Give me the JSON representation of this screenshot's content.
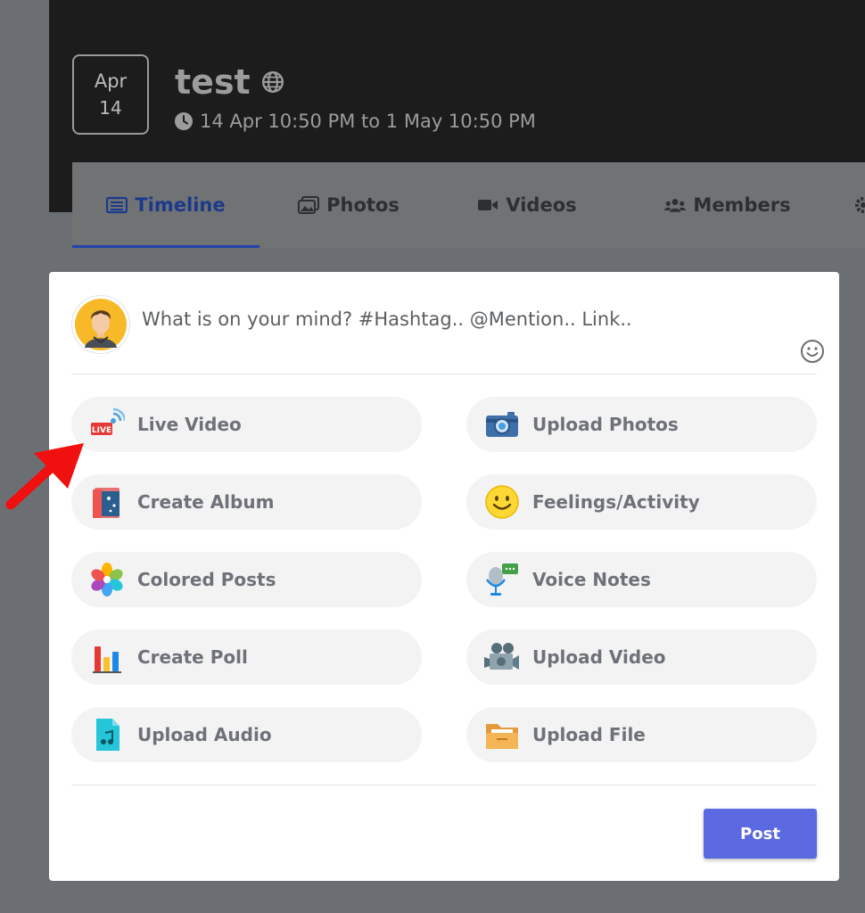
{
  "event": {
    "month": "Apr",
    "day": "14",
    "title": "test",
    "time": "14 Apr 10:50 PM to 1 May 10:50 PM"
  },
  "tabs": [
    {
      "label": "Timeline",
      "icon": "list-icon",
      "active": true
    },
    {
      "label": "Photos",
      "icon": "images-icon",
      "active": false
    },
    {
      "label": "Videos",
      "icon": "video-camera-icon",
      "active": false
    },
    {
      "label": "Members",
      "icon": "users-icon",
      "active": false
    }
  ],
  "composer": {
    "placeholder": "What is on your mind? #Hashtag.. @Mention.. Link..",
    "post_label": "Post",
    "options": [
      {
        "label": "Live Video",
        "icon": "live-video-icon"
      },
      {
        "label": "Upload Photos",
        "icon": "camera-icon"
      },
      {
        "label": "Create Album",
        "icon": "album-icon"
      },
      {
        "label": "Feelings/Activity",
        "icon": "smiley-icon"
      },
      {
        "label": "Colored Posts",
        "icon": "color-flower-icon"
      },
      {
        "label": "Voice Notes",
        "icon": "microphone-icon"
      },
      {
        "label": "Create Poll",
        "icon": "poll-icon"
      },
      {
        "label": "Upload Video",
        "icon": "video-icon"
      },
      {
        "label": "Upload Audio",
        "icon": "audio-file-icon"
      },
      {
        "label": "Upload File",
        "icon": "folder-icon"
      }
    ]
  },
  "colors": {
    "accent": "#5b6ae0",
    "tab_active": "#1b3a8c",
    "annotation_arrow": "#f01010"
  }
}
